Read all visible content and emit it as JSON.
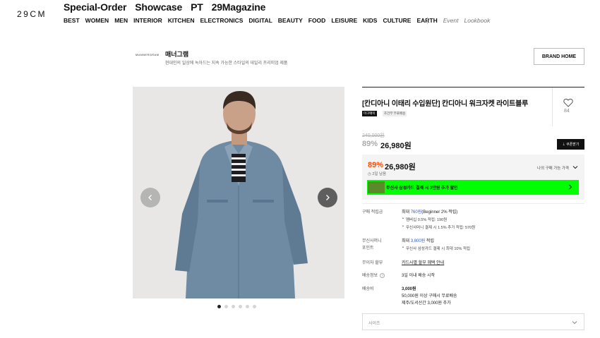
{
  "header": {
    "logo": "29CM",
    "top_nav": [
      "Special-Order",
      "Showcase",
      "PT",
      "29Magazine"
    ],
    "categories": [
      "BEST",
      "WOMEN",
      "MEN",
      "INTERIOR",
      "KITCHEN",
      "ELECTRONICS",
      "DIGITAL",
      "BEAUTY",
      "FOOD",
      "LEISURE",
      "KIDS",
      "CULTURE",
      "EARTH"
    ],
    "extra_links": [
      "Event",
      "Lookbook"
    ]
  },
  "brand": {
    "logo_text": "MANNERGRAM",
    "name": "매너그램",
    "description": "현대인의 일상에 녹아드는 지속 가능한 스타일의 데일리 프리미엄 제품",
    "home_button": "BRAND HOME"
  },
  "gallery": {
    "dot_count": 6,
    "active_index": 0
  },
  "product": {
    "title": "[칸디아니 이태리 수입원단] 칸디아니 워크자켓 라이트블루",
    "tags": [
      "미구매이",
      "조건부 무료배송"
    ],
    "like_count": "84",
    "original_price": "240,000원",
    "discount": "89%",
    "sale_price": "26,980원",
    "coupon_button": "⇣ 쿠폰받기"
  },
  "my_price": {
    "discount": "89%",
    "price": "26,980원",
    "time_left": "◷ 2일 남음",
    "label": "나의 구매 가능 가격",
    "card_promo": "무신사 삼성카드 결제 시 3만원 추가 할인"
  },
  "info": {
    "points_label": "구매 적립금",
    "points_prefix": "최대 ",
    "points_value": "760원",
    "points_suffix": "(Beginner 2% 적립)",
    "points_details": [
      "멤버십 0.5% 적립: 190원",
      "무신사머니 결제 시 1.5% 추가 적립: 570원"
    ],
    "money_label_1": "무신사머니",
    "money_label_2": "포인트",
    "money_prefix": "최대 ",
    "money_value": "3,800원",
    "money_suffix": " 적립",
    "money_details": [
      "무신사 삼성카드 결제 시 최대 10% 적립"
    ],
    "installment_label": "무이자 할부",
    "installment_value": "카드사별 할부 혜택 안내",
    "delivery_info_label": "배송정보",
    "delivery_info_value": "3일 이내 배송 시작",
    "shipping_label": "배송비",
    "shipping_fee": "3,000원",
    "shipping_free": "50,000원 이상 구매시 무료배송",
    "shipping_island": "제주/도서산간 3,000원 추가"
  },
  "size_select": {
    "placeholder": "사이즈"
  }
}
